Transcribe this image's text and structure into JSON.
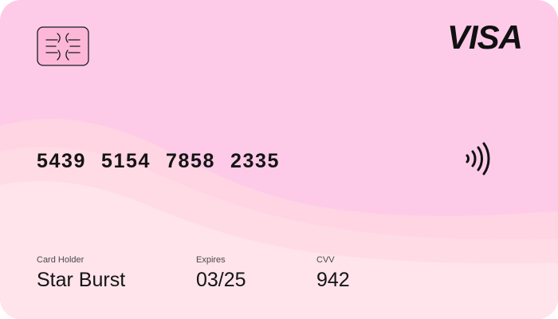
{
  "card": {
    "brand": "VISA",
    "number_groups": [
      "5439",
      "5154",
      "7858",
      "2335"
    ],
    "holder_label": "Card Holder",
    "holder_name": "Star Burst",
    "expires_label": "Expires",
    "expires_value": "03/25",
    "cvv_label": "CVV",
    "cvv_value": "942"
  },
  "icons": {
    "chip": "chip-icon",
    "contactless": "contactless-icon"
  },
  "colors": {
    "card_base": "#fdcbe8",
    "wave_mid": "#ffd3e1",
    "wave_low": "#ffe1ea",
    "text": "#141414"
  }
}
